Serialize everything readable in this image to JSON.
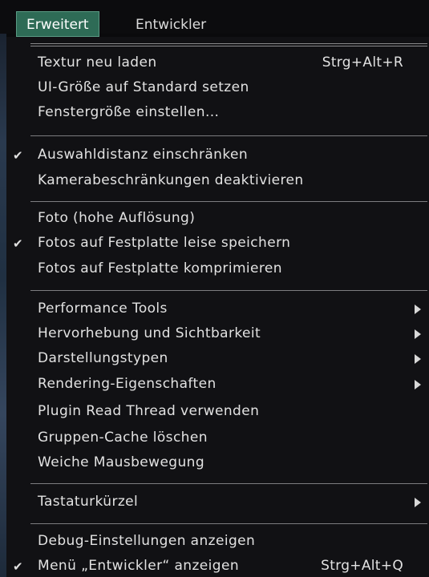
{
  "menubar": {
    "tabs": [
      {
        "label": "Erweitert"
      },
      {
        "label": "Entwickler"
      }
    ]
  },
  "menu": {
    "items": [
      {
        "label": "Textur neu laden",
        "shortcut": "Strg+Alt+R"
      },
      {
        "label": "UI-Größe auf Standard setzen"
      },
      {
        "label": "Fenstergröße einstellen..."
      },
      {
        "label": "Auswahldistanz einschränken",
        "checked": true,
        "check": "✔"
      },
      {
        "label": "Kamerabeschränkungen deaktivieren"
      },
      {
        "label": "Foto (hohe Auflösung)"
      },
      {
        "label": "Fotos auf Festplatte leise speichern",
        "checked": true,
        "check": "✔"
      },
      {
        "label": "Fotos auf Festplatte komprimieren"
      },
      {
        "label": "Performance Tools",
        "submenu": true
      },
      {
        "label": "Hervorhebung und Sichtbarkeit",
        "submenu": true
      },
      {
        "label": "Darstellungstypen",
        "submenu": true
      },
      {
        "label": "Rendering-Eigenschaften",
        "submenu": true
      },
      {
        "label": "Plugin Read Thread verwenden"
      },
      {
        "label": "Gruppen-Cache löschen"
      },
      {
        "label": "Weiche Mausbewegung"
      },
      {
        "label": "Tastaturkürzel",
        "submenu": true
      },
      {
        "label": "Debug-Einstellungen anzeigen"
      },
      {
        "label": "Menü „Entwickler“ anzeigen",
        "shortcut": "Strg+Alt+Q",
        "checked": true,
        "check": "✔"
      }
    ]
  },
  "colors": {
    "active_tab_bg": "#2e6b56",
    "menu_bg": "#111114",
    "separator": "#7d7d80"
  }
}
